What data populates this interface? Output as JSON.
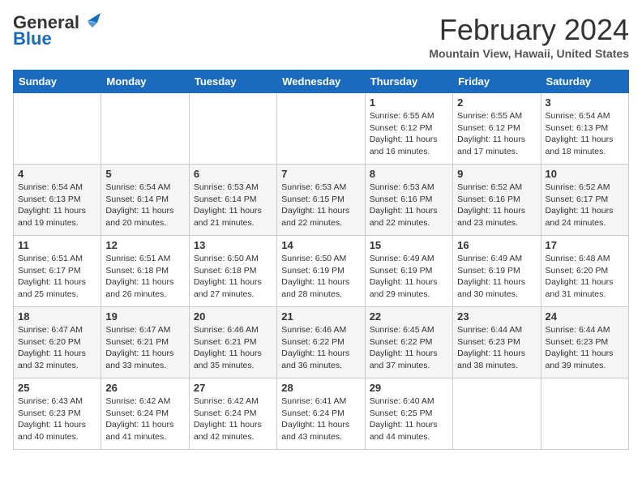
{
  "header": {
    "logo_line1": "General",
    "logo_line2": "Blue",
    "title": "February 2024",
    "subtitle": "Mountain View, Hawaii, United States"
  },
  "days_of_week": [
    "Sunday",
    "Monday",
    "Tuesday",
    "Wednesday",
    "Thursday",
    "Friday",
    "Saturday"
  ],
  "weeks": [
    [
      {
        "day": "",
        "info": ""
      },
      {
        "day": "",
        "info": ""
      },
      {
        "day": "",
        "info": ""
      },
      {
        "day": "",
        "info": ""
      },
      {
        "day": "1",
        "info": "Sunrise: 6:55 AM\nSunset: 6:12 PM\nDaylight: 11 hours\nand 16 minutes."
      },
      {
        "day": "2",
        "info": "Sunrise: 6:55 AM\nSunset: 6:12 PM\nDaylight: 11 hours\nand 17 minutes."
      },
      {
        "day": "3",
        "info": "Sunrise: 6:54 AM\nSunset: 6:13 PM\nDaylight: 11 hours\nand 18 minutes."
      }
    ],
    [
      {
        "day": "4",
        "info": "Sunrise: 6:54 AM\nSunset: 6:13 PM\nDaylight: 11 hours\nand 19 minutes."
      },
      {
        "day": "5",
        "info": "Sunrise: 6:54 AM\nSunset: 6:14 PM\nDaylight: 11 hours\nand 20 minutes."
      },
      {
        "day": "6",
        "info": "Sunrise: 6:53 AM\nSunset: 6:14 PM\nDaylight: 11 hours\nand 21 minutes."
      },
      {
        "day": "7",
        "info": "Sunrise: 6:53 AM\nSunset: 6:15 PM\nDaylight: 11 hours\nand 22 minutes."
      },
      {
        "day": "8",
        "info": "Sunrise: 6:53 AM\nSunset: 6:16 PM\nDaylight: 11 hours\nand 22 minutes."
      },
      {
        "day": "9",
        "info": "Sunrise: 6:52 AM\nSunset: 6:16 PM\nDaylight: 11 hours\nand 23 minutes."
      },
      {
        "day": "10",
        "info": "Sunrise: 6:52 AM\nSunset: 6:17 PM\nDaylight: 11 hours\nand 24 minutes."
      }
    ],
    [
      {
        "day": "11",
        "info": "Sunrise: 6:51 AM\nSunset: 6:17 PM\nDaylight: 11 hours\nand 25 minutes."
      },
      {
        "day": "12",
        "info": "Sunrise: 6:51 AM\nSunset: 6:18 PM\nDaylight: 11 hours\nand 26 minutes."
      },
      {
        "day": "13",
        "info": "Sunrise: 6:50 AM\nSunset: 6:18 PM\nDaylight: 11 hours\nand 27 minutes."
      },
      {
        "day": "14",
        "info": "Sunrise: 6:50 AM\nSunset: 6:19 PM\nDaylight: 11 hours\nand 28 minutes."
      },
      {
        "day": "15",
        "info": "Sunrise: 6:49 AM\nSunset: 6:19 PM\nDaylight: 11 hours\nand 29 minutes."
      },
      {
        "day": "16",
        "info": "Sunrise: 6:49 AM\nSunset: 6:19 PM\nDaylight: 11 hours\nand 30 minutes."
      },
      {
        "day": "17",
        "info": "Sunrise: 6:48 AM\nSunset: 6:20 PM\nDaylight: 11 hours\nand 31 minutes."
      }
    ],
    [
      {
        "day": "18",
        "info": "Sunrise: 6:47 AM\nSunset: 6:20 PM\nDaylight: 11 hours\nand 32 minutes."
      },
      {
        "day": "19",
        "info": "Sunrise: 6:47 AM\nSunset: 6:21 PM\nDaylight: 11 hours\nand 33 minutes."
      },
      {
        "day": "20",
        "info": "Sunrise: 6:46 AM\nSunset: 6:21 PM\nDaylight: 11 hours\nand 35 minutes."
      },
      {
        "day": "21",
        "info": "Sunrise: 6:46 AM\nSunset: 6:22 PM\nDaylight: 11 hours\nand 36 minutes."
      },
      {
        "day": "22",
        "info": "Sunrise: 6:45 AM\nSunset: 6:22 PM\nDaylight: 11 hours\nand 37 minutes."
      },
      {
        "day": "23",
        "info": "Sunrise: 6:44 AM\nSunset: 6:23 PM\nDaylight: 11 hours\nand 38 minutes."
      },
      {
        "day": "24",
        "info": "Sunrise: 6:44 AM\nSunset: 6:23 PM\nDaylight: 11 hours\nand 39 minutes."
      }
    ],
    [
      {
        "day": "25",
        "info": "Sunrise: 6:43 AM\nSunset: 6:23 PM\nDaylight: 11 hours\nand 40 minutes."
      },
      {
        "day": "26",
        "info": "Sunrise: 6:42 AM\nSunset: 6:24 PM\nDaylight: 11 hours\nand 41 minutes."
      },
      {
        "day": "27",
        "info": "Sunrise: 6:42 AM\nSunset: 6:24 PM\nDaylight: 11 hours\nand 42 minutes."
      },
      {
        "day": "28",
        "info": "Sunrise: 6:41 AM\nSunset: 6:24 PM\nDaylight: 11 hours\nand 43 minutes."
      },
      {
        "day": "29",
        "info": "Sunrise: 6:40 AM\nSunset: 6:25 PM\nDaylight: 11 hours\nand 44 minutes."
      },
      {
        "day": "",
        "info": ""
      },
      {
        "day": "",
        "info": ""
      }
    ]
  ]
}
